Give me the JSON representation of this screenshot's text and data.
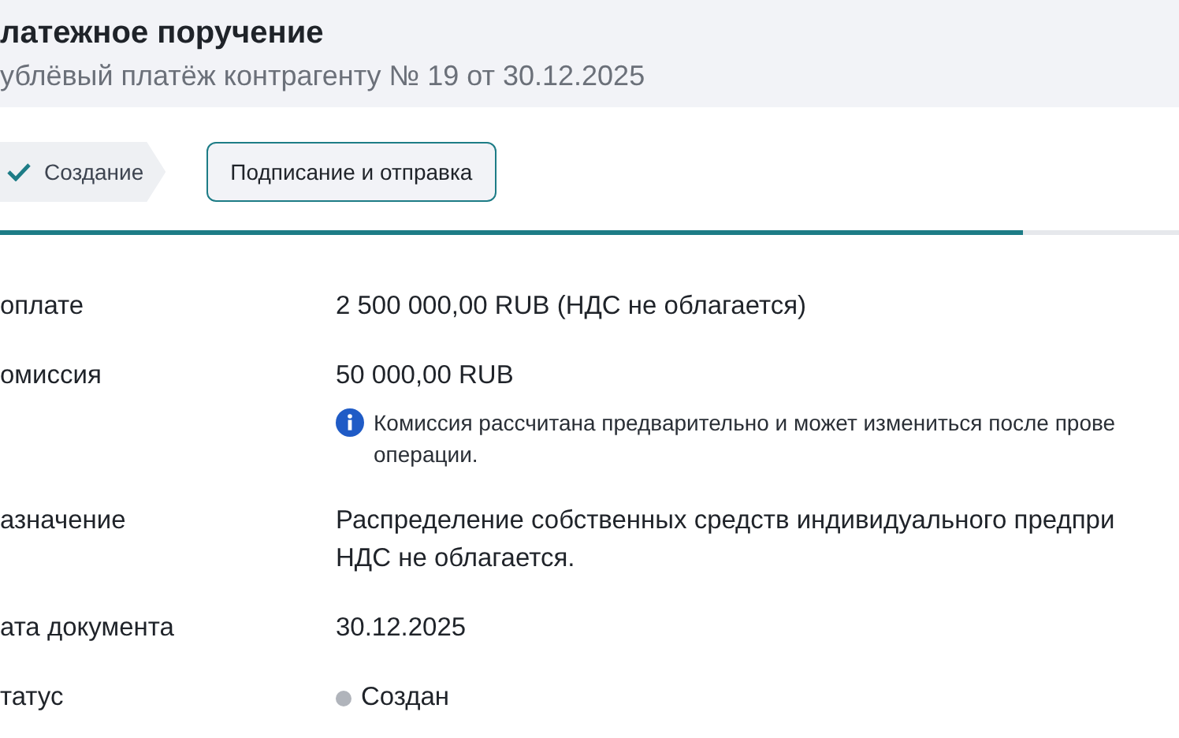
{
  "header": {
    "title": "латежное поручение",
    "subtitle": "ублёвый платёж контрагенту № 19 от 30.12.2025"
  },
  "steps": [
    {
      "label": "Создание",
      "done": true,
      "selected": false
    },
    {
      "label": "Подписание и отправка",
      "done": false,
      "selected": true
    }
  ],
  "progress": {
    "level": 0.868
  },
  "fields": [
    {
      "label": "оплате",
      "value": "2 500 000,00 RUB (НДС не облагается)"
    },
    {
      "label": "омиссия",
      "value": "50 000,00 RUB",
      "note": "Комиссия рассчитана предварительно и может измениться после прове операции."
    },
    {
      "label": "азначение",
      "value": "Распределение собственных средств индивидуального предпри НДС не облагается."
    },
    {
      "label": "ата документа",
      "value": "30.12.2025"
    },
    {
      "label": "татус",
      "value": "Создан",
      "color": "#b0b4bb"
    }
  ]
}
